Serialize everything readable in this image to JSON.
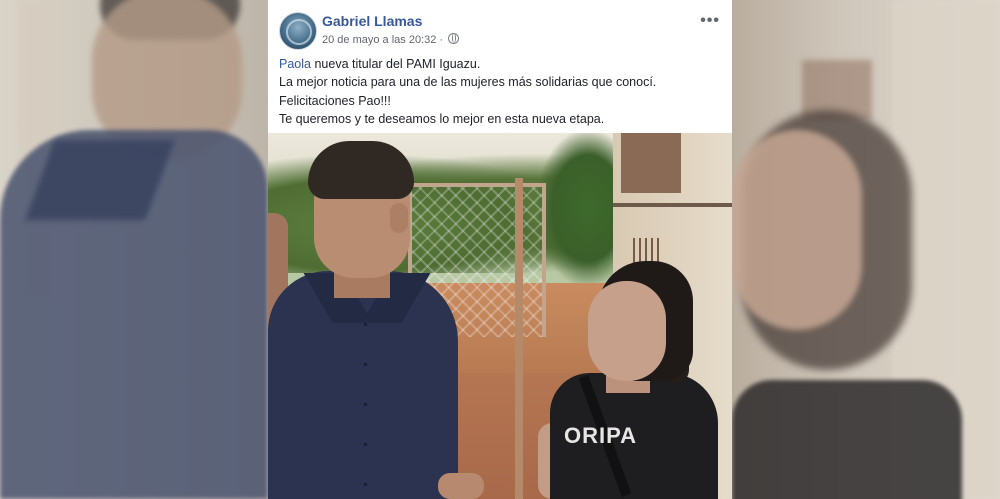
{
  "post": {
    "author": "Gabriel Llamas",
    "timestamp": "20 de mayo a las 20:32 ·",
    "privacy_icon": "globe-icon",
    "more_icon": "more-options-icon",
    "text": {
      "mention": "Paola",
      "line1_rest": " nueva titular del PAMI Iguazu.",
      "line2": "La mejor noticia para una de las mujeres más solidarias que conocí.",
      "line3": "Felicitaciones Pao!!!",
      "line4": "Te queremos y te deseamos lo mejor en esta nueva etapa."
    },
    "photo": {
      "shirt_print": "ORIPA"
    }
  },
  "colors": {
    "link": "#385898",
    "text": "#1d2129",
    "meta": "#616770",
    "card_bg": "#ffffff"
  }
}
